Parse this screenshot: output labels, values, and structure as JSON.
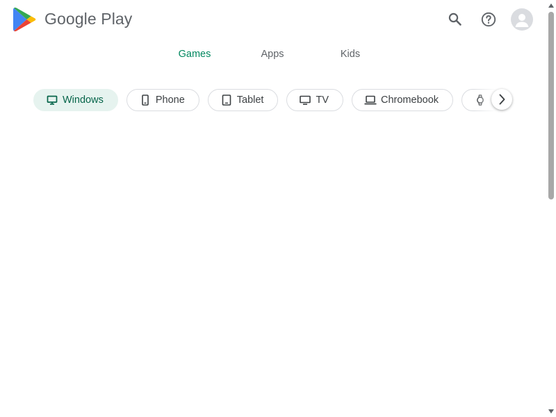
{
  "header": {
    "logo_text": "Google Play",
    "icons": {
      "search": "search-icon",
      "help": "help-icon",
      "account": "account-avatar"
    }
  },
  "tabs": [
    {
      "label": "Games",
      "active": true
    },
    {
      "label": "Apps",
      "active": false
    },
    {
      "label": "Kids",
      "active": false
    }
  ],
  "device_chips": [
    {
      "label": "Windows",
      "icon": "monitor-icon",
      "selected": true
    },
    {
      "label": "Phone",
      "icon": "phone-icon",
      "selected": false
    },
    {
      "label": "Tablet",
      "icon": "tablet-icon",
      "selected": false
    },
    {
      "label": "TV",
      "icon": "tv-icon",
      "selected": false
    },
    {
      "label": "Chromebook",
      "icon": "laptop-icon",
      "selected": false
    },
    {
      "label": "",
      "icon": "watch-icon",
      "selected": false
    }
  ],
  "colors": {
    "accent": "#01875f",
    "chip_selected_bg": "#e6f3ef",
    "chip_selected_text": "#056449",
    "text_secondary": "#5f6368",
    "border": "#dadce0"
  }
}
